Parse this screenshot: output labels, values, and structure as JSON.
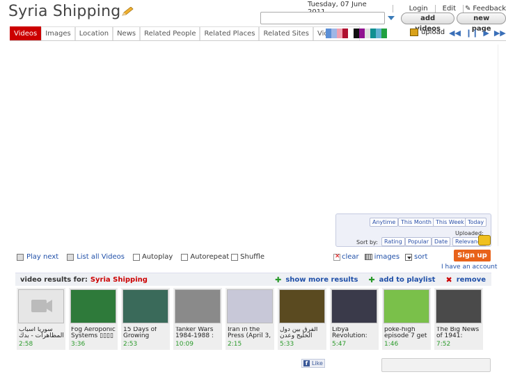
{
  "site": {
    "title": "Syria Shipping"
  },
  "topbar": {
    "date": "Tuesday, 07 June 2011",
    "login": "Login",
    "edit": "Edit",
    "feedback": "Feedback"
  },
  "search": {
    "value": "",
    "add_videos": "add videos",
    "new_page": "new page"
  },
  "tabs": [
    "Videos",
    "Images",
    "Location",
    "News",
    "Related People",
    "Related Places",
    "Related Sites",
    "Video Deta"
  ],
  "swatches": [
    "#5b8fd6",
    "#9fb6e6",
    "#f0a0b0",
    "#b01030",
    "#ffffff",
    "#101010",
    "#901090",
    "#e0e0e0",
    "#109090",
    "#60b0d0",
    "#20a040",
    "#ffffff"
  ],
  "toolbar": {
    "upload": "upload"
  },
  "filters": {
    "anytime": "Anytime",
    "this_month": "This Month",
    "this_week": "This Week",
    "today": "Today",
    "uploaded": "Uploaded:",
    "sort_by": "Sort by:",
    "rating": "Rating",
    "popular": "Popular",
    "date": "Date",
    "relevance": "Relevance"
  },
  "controls": {
    "play_next": "Play next",
    "list_all": "List all Videos",
    "autoplay": "Autoplay",
    "autorepeat": "Autorepeat",
    "shuffle": "Shuffle",
    "clear": "clear",
    "images": "images",
    "sort": "sort"
  },
  "auth": {
    "signup": "Sign up",
    "have_account": "I have an account"
  },
  "results": {
    "label": "video results for:",
    "query": "Syria Shipping",
    "show_more": "show more results",
    "add_playlist": "add to playlist",
    "remove": "remove"
  },
  "videos": [
    {
      "title": "سوريا أسباب المظاهرات - بدك",
      "duration": "2:58",
      "color": "#e6e6e6"
    },
    {
      "title": "Fog Aeroponic Systems ▯▯▯▯",
      "duration": "3:36",
      "color": "#2e7a3a"
    },
    {
      "title": "15 Days of Growing",
      "duration": "2:53",
      "color": "#3a6a5a"
    },
    {
      "title": "Tanker Wars 1984-1988 :",
      "duration": "10:09",
      "color": "#8a8a8a"
    },
    {
      "title": "Iran in the Press (April 3,",
      "duration": "2:15",
      "color": "#c8c8d8"
    },
    {
      "title": "الفرق بين دول الخليج وعدن",
      "duration": "5:33",
      "color": "#5a4a20"
    },
    {
      "title": "Libya Revolution:",
      "duration": "5:47",
      "color": "#3a3a4a"
    },
    {
      "title": "poke-high episode 7 get",
      "duration": "1:46",
      "color": "#7ac04a"
    },
    {
      "title": "The Big News of 1941:",
      "duration": "7:52",
      "color": "#4a4a4a"
    }
  ],
  "social": {
    "like": "Like"
  }
}
